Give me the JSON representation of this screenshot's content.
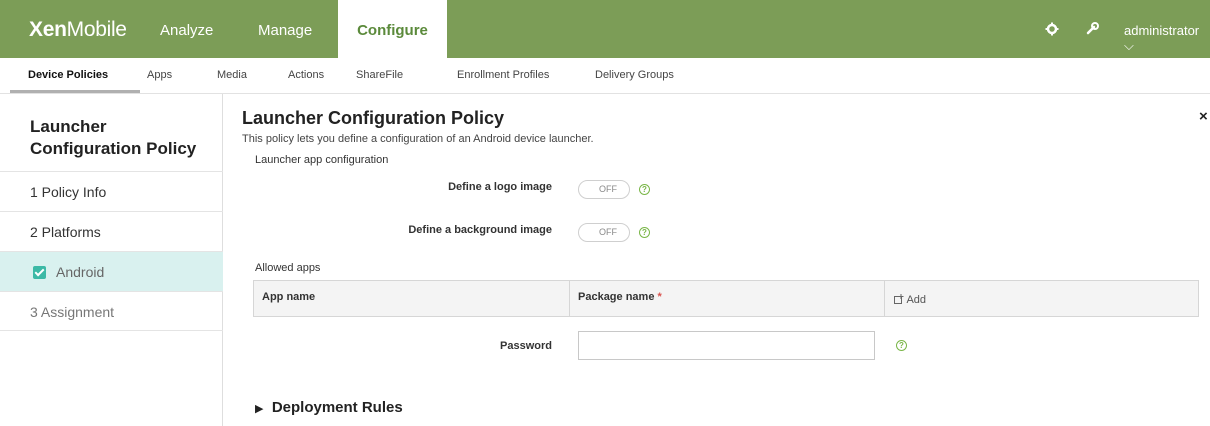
{
  "brand": {
    "bold": "Xen",
    "light": "Mobile"
  },
  "nav": {
    "analyze": "Analyze",
    "manage": "Manage",
    "configure": "Configure"
  },
  "topbar": {
    "settings_icon": "gear-icon",
    "tools_icon": "wrench-icon",
    "user": "administrator",
    "user_caret": "⌵"
  },
  "subnav": {
    "device_policies": "Device Policies",
    "apps": "Apps",
    "media": "Media",
    "actions": "Actions",
    "sharefile": "ShareFile",
    "enrollment_profiles": "Enrollment Profiles",
    "delivery_groups": "Delivery Groups"
  },
  "sidebar": {
    "title": "Launcher Configuration Policy",
    "items": [
      "1  Policy Info",
      "2  Platforms",
      "Android",
      "3  Assignment"
    ]
  },
  "main": {
    "title": "Launcher Configuration Policy",
    "description": "This policy lets you define a configuration of an Android device launcher.",
    "section_launcher": "Launcher app configuration",
    "logo_label": "Define a logo image",
    "logo_toggle": "OFF",
    "background_label": "Define a background image",
    "background_toggle": "OFF",
    "help_glyph": "?",
    "allowed_apps_label": "Allowed apps",
    "table": {
      "col_app_name": "App name",
      "col_package_name": "Package name",
      "required_mark": "*",
      "add": "Add"
    },
    "password_label": "Password",
    "password_value": "",
    "deployment_rules": "Deployment Rules",
    "close": "×"
  },
  "colors": {
    "topbar": "#7c9d57",
    "accent": "#5b8a3b",
    "checkbox": "#3cb9a6",
    "sidebar_selected": "#d9f1ef",
    "help": "#7ab648"
  }
}
